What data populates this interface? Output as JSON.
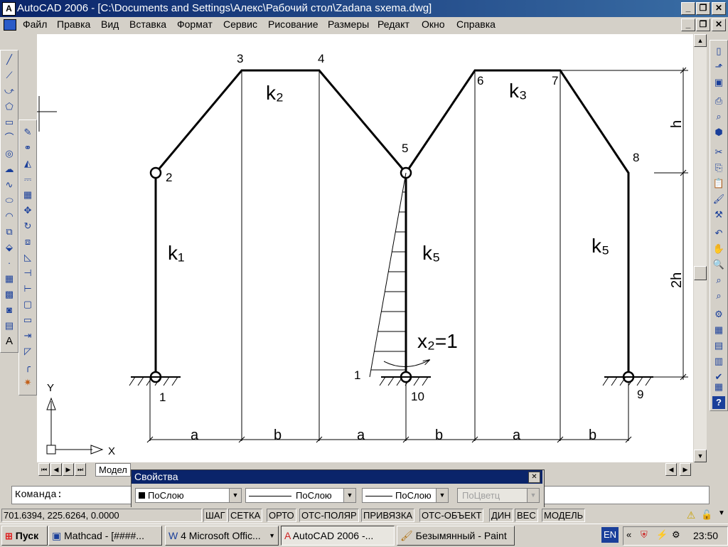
{
  "window": {
    "title": "AutoCAD 2006 - [C:\\Documents and Settings\\Алекс\\Рабочий стол\\Zadana sxema.dwg]",
    "btn_min": "_",
    "btn_max": "❐",
    "btn_close": "✕"
  },
  "menu": [
    "Файл",
    "Правка",
    "Вид",
    "Вставка",
    "Формат",
    "Сервис",
    "Рисование",
    "Размеры",
    "Редакт",
    "Окно",
    "Справка"
  ],
  "drawing": {
    "node_labels": [
      "1",
      "2",
      "3",
      "4",
      "5",
      "6",
      "7",
      "8",
      "9",
      "10"
    ],
    "member_labels": [
      "k₁",
      "k₂",
      "k₃",
      "k₅",
      "k₅"
    ],
    "dim_labels": [
      "a",
      "b",
      "a",
      "b",
      "a",
      "b"
    ],
    "vdim_labels": [
      "h",
      "2h"
    ],
    "load_label": "x₂=1",
    "load_value": "1",
    "ucs_x": "X",
    "ucs_y": "Y"
  },
  "tabs": {
    "model": "Модел"
  },
  "properties": {
    "title": "Свойства",
    "color": "ПоСлою",
    "linetype": "ПоСлою",
    "lineweight": "ПоСлою",
    "plotstyle": "ПоЦветц"
  },
  "command": {
    "prompt": "Команда:"
  },
  "status": {
    "coords": "701.6394, 225.6264, 0.0000",
    "buttons": [
      "ШАГ",
      "СЕТКА",
      "ОРТО",
      "ОТС-ПОЛЯР",
      "ПРИВЯЗКА",
      "ОТС-ОБЪЕКТ",
      "ДИН",
      "ВЕС",
      "МОДЕЛЬ"
    ]
  },
  "taskbar": {
    "start": "Пуск",
    "tasks": [
      "Mathcad - [####...",
      "4 Microsoft Offic...",
      "AutoCAD 2006 -...",
      "Безымянный - Paint"
    ],
    "lang": "EN",
    "time": "23:50"
  }
}
